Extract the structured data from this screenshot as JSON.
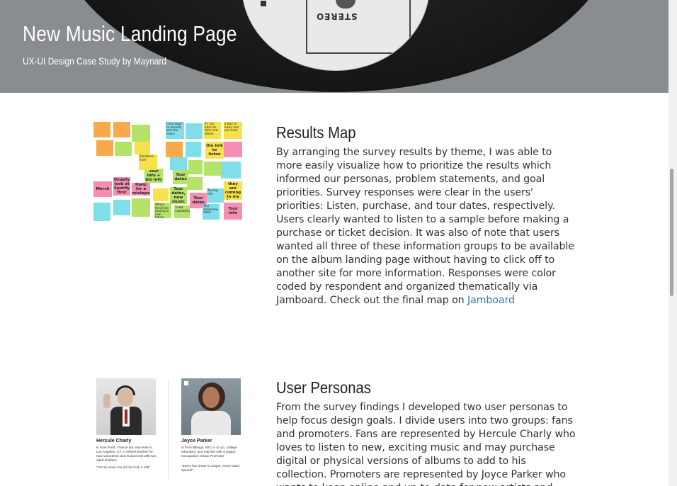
{
  "hero": {
    "title": "New Music Landing Page",
    "subtitle": "UX-UI Design Case Study by Maynard",
    "record_label_text": "STEREO"
  },
  "sections": [
    {
      "heading": "Results Map",
      "body": "By arranging the survey results by theme, I was able to more easily visualize how to prioritize the results which informed our personas, problem statements, and goal priorities. Survey responses were clear in the users' priorities: Listen, purchase, and tour dates, respectively. Users clearly wanted to listen to a sample before making a purchase or ticket decision. It was also of note that users wanted all three of these information groups to be available on the album landing page without having to click off to another site for more information. Responses were color coded by respondent and organized thematically via Jamboard. Check out the final map on",
      "link_text": "Jamboard"
    },
    {
      "heading": "User Personas",
      "body": "From the survey findings I developed two user personas to help focus design goals. I divide users into two groups: fans and promoters. Fans are represented by Hercule Charly who loves to listen to new, exciting music and may purchase digital or physical versions of albums to add to his collection. Promoters are represented by Joyce Parker who wants to keep online and up-to-date for new artists and tour dates."
    }
  ],
  "results_map_notes": [
    {
      "text": "Tour info + bio info",
      "color": "#b5e36a"
    },
    {
      "text": "Tour dates",
      "color": "#b5e36a"
    },
    {
      "text": "the link to listen",
      "color": "#f7e24b"
    },
    {
      "text": "If I can listen to their new album",
      "color": "#f7e24b"
    },
    {
      "text": "a way to listen and purchase",
      "color": "#f7e24b"
    },
    {
      "text": "Merch",
      "color": "#f48fb1"
    },
    {
      "text": "Usually look at Spotify first",
      "color": "#f48fb1"
    },
    {
      "text": "Hjelp for a mixtape",
      "color": "#f48fb1"
    },
    {
      "text": "Bio/where from",
      "color": "#f7e24b"
    },
    {
      "text": "Tour dates, new music",
      "color": "#b5e36a"
    },
    {
      "text": "Tour dates",
      "color": "#f48fb1"
    },
    {
      "text": "Touring info",
      "color": "#80deea"
    },
    {
      "text": "Tour. If they are coming to my town.",
      "color": "#f7e24b"
    },
    {
      "text": "Tour info",
      "color": "#f48fb1"
    },
    {
      "text": "Ticket availability",
      "color": "#b5e36a"
    },
    {
      "text": "Clear ways to actually own the music",
      "color": "#80deea"
    },
    {
      "text": "Where they'll be playing in near future",
      "color": "#b5e36a"
    },
    {
      "text": "Tour dates/new dates",
      "color": "#80deea"
    }
  ],
  "personas": [
    {
      "name": "Hercule Charly",
      "description": "Is from Paris, France but now lives in Los Angeles, CA. A retired teacher he now volunteers and is divorced with two adult children.",
      "quote": "\"You're never too old for rock n roll!\""
    },
    {
      "name": "Joyce Parker",
      "description": "Is from Billings, MO, is 42 yo, college educated, and married with a puppy. Occupation: Music Promoter",
      "quote": "\"Every live show is unique, every band special\""
    }
  ]
}
